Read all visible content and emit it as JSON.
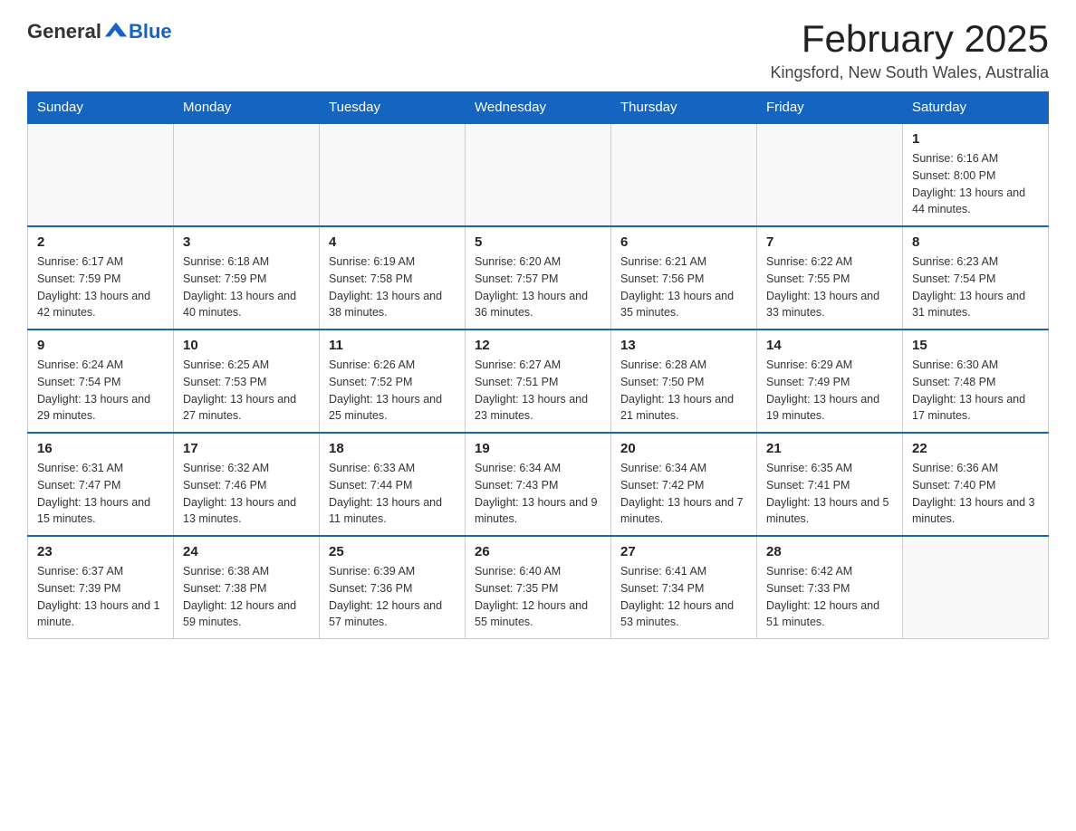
{
  "header": {
    "logo_general": "General",
    "logo_blue": "Blue",
    "title": "February 2025",
    "location": "Kingsford, New South Wales, Australia"
  },
  "weekdays": [
    "Sunday",
    "Monday",
    "Tuesday",
    "Wednesday",
    "Thursday",
    "Friday",
    "Saturday"
  ],
  "weeks": [
    [
      {
        "day": "",
        "info": ""
      },
      {
        "day": "",
        "info": ""
      },
      {
        "day": "",
        "info": ""
      },
      {
        "day": "",
        "info": ""
      },
      {
        "day": "",
        "info": ""
      },
      {
        "day": "",
        "info": ""
      },
      {
        "day": "1",
        "info": "Sunrise: 6:16 AM\nSunset: 8:00 PM\nDaylight: 13 hours and 44 minutes."
      }
    ],
    [
      {
        "day": "2",
        "info": "Sunrise: 6:17 AM\nSunset: 7:59 PM\nDaylight: 13 hours and 42 minutes."
      },
      {
        "day": "3",
        "info": "Sunrise: 6:18 AM\nSunset: 7:59 PM\nDaylight: 13 hours and 40 minutes."
      },
      {
        "day": "4",
        "info": "Sunrise: 6:19 AM\nSunset: 7:58 PM\nDaylight: 13 hours and 38 minutes."
      },
      {
        "day": "5",
        "info": "Sunrise: 6:20 AM\nSunset: 7:57 PM\nDaylight: 13 hours and 36 minutes."
      },
      {
        "day": "6",
        "info": "Sunrise: 6:21 AM\nSunset: 7:56 PM\nDaylight: 13 hours and 35 minutes."
      },
      {
        "day": "7",
        "info": "Sunrise: 6:22 AM\nSunset: 7:55 PM\nDaylight: 13 hours and 33 minutes."
      },
      {
        "day": "8",
        "info": "Sunrise: 6:23 AM\nSunset: 7:54 PM\nDaylight: 13 hours and 31 minutes."
      }
    ],
    [
      {
        "day": "9",
        "info": "Sunrise: 6:24 AM\nSunset: 7:54 PM\nDaylight: 13 hours and 29 minutes."
      },
      {
        "day": "10",
        "info": "Sunrise: 6:25 AM\nSunset: 7:53 PM\nDaylight: 13 hours and 27 minutes."
      },
      {
        "day": "11",
        "info": "Sunrise: 6:26 AM\nSunset: 7:52 PM\nDaylight: 13 hours and 25 minutes."
      },
      {
        "day": "12",
        "info": "Sunrise: 6:27 AM\nSunset: 7:51 PM\nDaylight: 13 hours and 23 minutes."
      },
      {
        "day": "13",
        "info": "Sunrise: 6:28 AM\nSunset: 7:50 PM\nDaylight: 13 hours and 21 minutes."
      },
      {
        "day": "14",
        "info": "Sunrise: 6:29 AM\nSunset: 7:49 PM\nDaylight: 13 hours and 19 minutes."
      },
      {
        "day": "15",
        "info": "Sunrise: 6:30 AM\nSunset: 7:48 PM\nDaylight: 13 hours and 17 minutes."
      }
    ],
    [
      {
        "day": "16",
        "info": "Sunrise: 6:31 AM\nSunset: 7:47 PM\nDaylight: 13 hours and 15 minutes."
      },
      {
        "day": "17",
        "info": "Sunrise: 6:32 AM\nSunset: 7:46 PM\nDaylight: 13 hours and 13 minutes."
      },
      {
        "day": "18",
        "info": "Sunrise: 6:33 AM\nSunset: 7:44 PM\nDaylight: 13 hours and 11 minutes."
      },
      {
        "day": "19",
        "info": "Sunrise: 6:34 AM\nSunset: 7:43 PM\nDaylight: 13 hours and 9 minutes."
      },
      {
        "day": "20",
        "info": "Sunrise: 6:34 AM\nSunset: 7:42 PM\nDaylight: 13 hours and 7 minutes."
      },
      {
        "day": "21",
        "info": "Sunrise: 6:35 AM\nSunset: 7:41 PM\nDaylight: 13 hours and 5 minutes."
      },
      {
        "day": "22",
        "info": "Sunrise: 6:36 AM\nSunset: 7:40 PM\nDaylight: 13 hours and 3 minutes."
      }
    ],
    [
      {
        "day": "23",
        "info": "Sunrise: 6:37 AM\nSunset: 7:39 PM\nDaylight: 13 hours and 1 minute."
      },
      {
        "day": "24",
        "info": "Sunrise: 6:38 AM\nSunset: 7:38 PM\nDaylight: 12 hours and 59 minutes."
      },
      {
        "day": "25",
        "info": "Sunrise: 6:39 AM\nSunset: 7:36 PM\nDaylight: 12 hours and 57 minutes."
      },
      {
        "day": "26",
        "info": "Sunrise: 6:40 AM\nSunset: 7:35 PM\nDaylight: 12 hours and 55 minutes."
      },
      {
        "day": "27",
        "info": "Sunrise: 6:41 AM\nSunset: 7:34 PM\nDaylight: 12 hours and 53 minutes."
      },
      {
        "day": "28",
        "info": "Sunrise: 6:42 AM\nSunset: 7:33 PM\nDaylight: 12 hours and 51 minutes."
      },
      {
        "day": "",
        "info": ""
      }
    ]
  ]
}
